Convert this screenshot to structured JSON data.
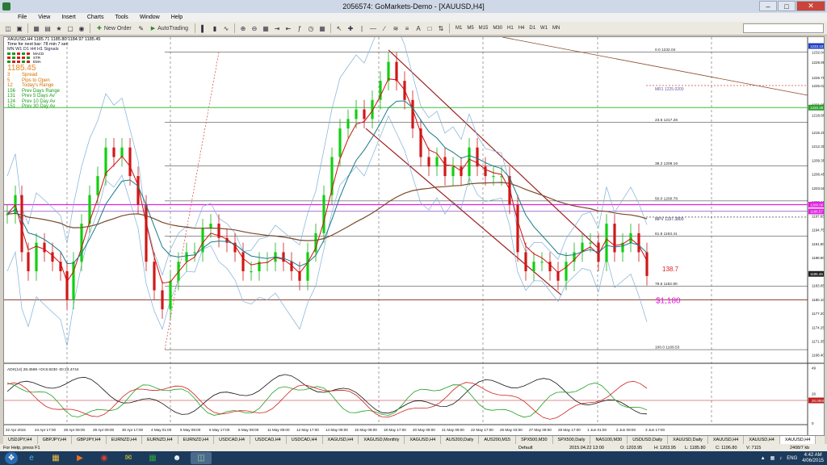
{
  "window": {
    "title": "2056574: GoMarkets-Demo - [XAUUSD,H4]"
  },
  "menu": [
    "File",
    "View",
    "Insert",
    "Charts",
    "Tools",
    "Window",
    "Help"
  ],
  "toolbar": {
    "new_order": "New Order",
    "autotrading": "AutoTrading",
    "timeframes": [
      "M1",
      "M5",
      "M15",
      "M30",
      "H1",
      "H4",
      "D1",
      "W1",
      "MN"
    ]
  },
  "chart": {
    "header": "XAUUSD,H4  1185.71 1185.80 1184.97 1185.45",
    "timer": "Time for next bar: 78 min 7 sec",
    "signals_header": "MN W1 D1 H4 H1 Signals",
    "signals_rows": [
      "MACD",
      "STR",
      "EMA"
    ],
    "price": "1185.45",
    "stats": [
      {
        "n": "3",
        "label": "Spread",
        "color": "#d07000"
      },
      {
        "n": "5",
        "label": "Pips to Open",
        "color": "#d07000"
      },
      {
        "n": "12",
        "label": "Today's Range",
        "color": "#d07000"
      },
      {
        "n": "156",
        "label": "Prev Days Range",
        "color": "#1a9a1a"
      },
      {
        "n": "131",
        "label": "Prev 5 Days Av",
        "color": "#1a9a1a"
      },
      {
        "n": "124",
        "label": "Prev 10 Day Av",
        "color": "#1a9a1a"
      },
      {
        "n": "151",
        "label": "Prev 30 Day Av",
        "color": "#1a9a1a"
      }
    ],
    "fib_labels": [
      "0.0 1232.04",
      "23.6 1217.26",
      "38.2 1208.16",
      "50.0 1200.78",
      "61.8 1193.41",
      "78.6 1182.90",
      "100.0 1169.53"
    ],
    "mr1": "MR1  1225.0200",
    "mpv": "MPV  1197.3800",
    "annotation_pips": "138.7",
    "annotation_price": "$1,180",
    "price_axis": [
      "1232.04",
      "1229.95",
      "1226.70",
      "1225.02",
      "1221.05",
      "1218.80",
      "1215.20",
      "1212.30",
      "1209.35",
      "1206.45",
      "1203.50",
      "1200.60",
      "1198.57",
      "1197.65",
      "1194.75",
      "1191.80",
      "1188.90",
      "1185.45",
      "1183.05",
      "1180.10",
      "1177.20",
      "1174.25",
      "1171.35",
      "1168.40"
    ],
    "price_axis_highlights": {
      "top": "1233.33",
      "green": "1220.39",
      "magenta1": "1200.00",
      "magenta2": "1198.57",
      "current": "1185.45"
    },
    "adx_label": "ADX(14) 28.4569 +DI:8.8230 -DI:14.4744",
    "adx_axis": [
      "49",
      "26",
      "20.0000",
      "0"
    ],
    "time_axis": [
      "22 Apr 2015",
      "24 Apr 17:00",
      "28 Apr 09:00",
      "29 Apr 09:00",
      "30 Apr 17:00",
      "4 May 01:00",
      "5 May 09:00",
      "6 May 17:00",
      "8 May 09:00",
      "11 May 09:00",
      "12 May 17:00",
      "14 May 09:00",
      "15 May 09:00",
      "18 May 17:00",
      "20 May 09:00",
      "21 May 09:00",
      "22 May 17:00",
      "26 May 03:00",
      "27 May 09:00",
      "28 May 17:00",
      "1 Jun 01:00",
      "2 Jun 09:00",
      "3 Jun 17:00"
    ]
  },
  "tabs": [
    "USDJPY,H4",
    "GBPJPY,H4",
    "GBPJPY,H4",
    "EURNZD,H4",
    "EURNZD,H4",
    "EURNZD,H4",
    "USDCAD,H4",
    "USDCAD,H4",
    "USDCAD,H4",
    "XAGUSD,H4",
    "XAGUSD,Monthly",
    "XAGUSD,H4",
    "AUS200,Daily",
    "AUS200,M15",
    "SPX500,M30",
    "SPX500,Daily",
    "NAS100,M30",
    "USDUSD,Daily",
    "XAUUSD,Daily",
    "XAUUSD,H4",
    "XAUUSD,H4",
    "XAUUSD,H4"
  ],
  "status": {
    "help": "For Help, press F1",
    "profile": "Default",
    "datetime": "2015.04.22 13:00",
    "o": "O: 1203.95",
    "h": "H: 1203.95",
    "l": "L: 1185.80",
    "c": "C: 1196.80",
    "v": "V: 7115",
    "mem": "2408/7 kb"
  },
  "taskbar": {
    "lang": "ENG",
    "time": "4:42 AM",
    "date": "4/06/2015"
  }
}
